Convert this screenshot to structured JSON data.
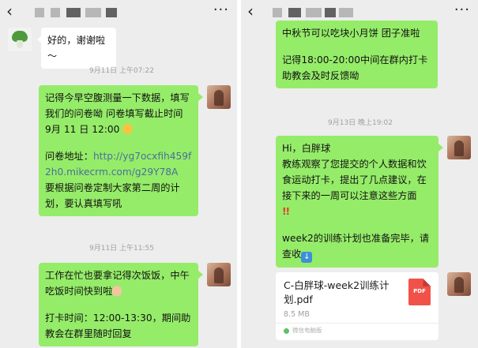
{
  "left": {
    "header": {
      "back_icon": "chevron-left-icon",
      "more_icon": "more-dots-icon"
    },
    "messages": {
      "m1": {
        "text": "好的，谢谢啦～"
      },
      "ts1": "9月11日 上午07:22",
      "m2": {
        "line1": "记得今早空腹测量一下数据，填写我们的问卷呦  问卷填写截止时间 9月 11 日 12:00",
        "line2": "问卷地址：",
        "link": "http://yg7ocxfih459f2h0.mikecrm.com/g29Y78A",
        "line3": "要根据问卷定制大家第二周的计划，要认真填写吼"
      },
      "ts2": "9月11日 上午11:55",
      "m3": {
        "line1": "工作在忙也要拿记得次饭饭，中午吃饭时间快到啦",
        "line2": "打卡时间：12:00-13:30，期间助教会在群里随时回复"
      }
    }
  },
  "right": {
    "header": {
      "back_icon": "chevron-left-icon",
      "more_icon": "more-dots-icon"
    },
    "messages": {
      "m1": {
        "line1": "中秋节可以吃块小月饼  团子准啦",
        "line2": "记得18:00-20:00中间在群内打卡助教会及时反馈呦"
      },
      "ts1": "9月13日 晚上19:02",
      "m2": {
        "line1": "Hi，白胖球",
        "line2": "教练观察了您提交的个人数据和饮食运动打卡，提出了几点建议，在接下来的一周可以注意这些方面",
        "line3": "week2的训练计划也准备完毕，请查收"
      },
      "file": {
        "name": "C-白胖球-week2训练计划.pdf",
        "size": "8.5 MB",
        "icon_label": "PDF",
        "source": "微信电脑版"
      }
    }
  },
  "colors": {
    "bubble_green": "#95ec69",
    "chat_bg": "#ededed",
    "timestamp": "#a0a0a0",
    "pdf_red": "#f0524a"
  }
}
